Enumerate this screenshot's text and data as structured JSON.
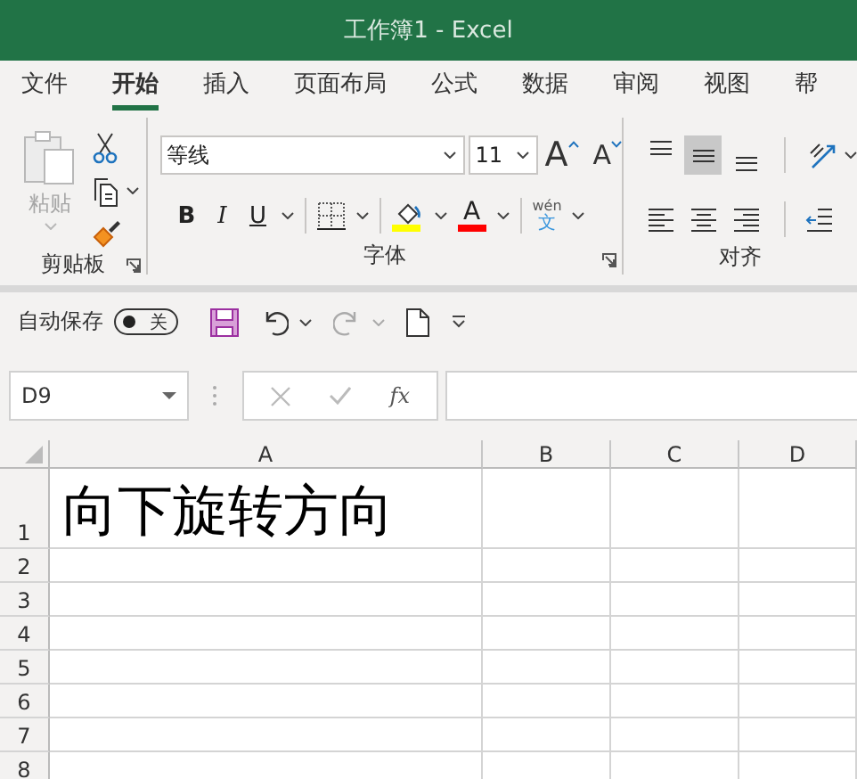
{
  "window": {
    "title": "工作簿1 - Excel"
  },
  "tabs": [
    {
      "label": "文件",
      "selected": false
    },
    {
      "label": "开始",
      "selected": true
    },
    {
      "label": "插入",
      "selected": false
    },
    {
      "label": "页面布局",
      "selected": false
    },
    {
      "label": "公式",
      "selected": false
    },
    {
      "label": "数据",
      "selected": false
    },
    {
      "label": "审阅",
      "selected": false
    },
    {
      "label": "视图",
      "selected": false
    },
    {
      "label": "帮",
      "selected": false
    }
  ],
  "clipboard": {
    "paste_label": "粘贴",
    "paste_disabled": true,
    "group_label": "剪贴板"
  },
  "font": {
    "name": "等线",
    "size": "11",
    "grow": "A",
    "shrink": "A",
    "bold": "B",
    "italic": "I",
    "underline": "U",
    "font_color": "A",
    "phonetic_top": "wén",
    "phonetic_bottom": "文",
    "group_label": "字体"
  },
  "alignment": {
    "vertical": [
      {
        "kind": "top",
        "selected": false
      },
      {
        "kind": "middle",
        "selected": true
      },
      {
        "kind": "bottom",
        "selected": false
      }
    ],
    "horizontal": [
      {
        "kind": "left",
        "selected": false
      },
      {
        "kind": "center",
        "selected": false
      },
      {
        "kind": "right",
        "selected": false
      }
    ],
    "group_label": "对齐"
  },
  "quick_access": {
    "autosave_label": "自动保存",
    "autosave": {
      "on": false,
      "label": "关"
    }
  },
  "formula_bar": {
    "name_box": "D9",
    "fx": "fx"
  },
  "sheet": {
    "columns": [
      "A",
      "B",
      "C",
      "D"
    ],
    "rows": [
      {
        "header": "1",
        "cells": [
          "向下旋转方向"
        ]
      },
      {
        "header": "2"
      },
      {
        "header": "3"
      },
      {
        "header": "4"
      },
      {
        "header": "5"
      },
      {
        "header": "6"
      },
      {
        "header": "7"
      },
      {
        "header": "8"
      }
    ]
  }
}
